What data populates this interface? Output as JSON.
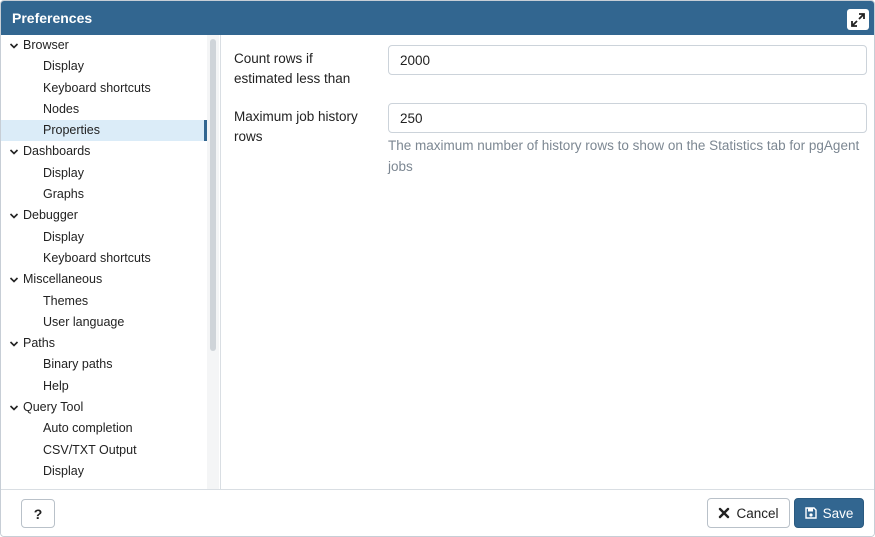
{
  "dialog": {
    "title": "Preferences"
  },
  "sidebar": {
    "tree": [
      {
        "label": "Browser",
        "level": "group"
      },
      {
        "label": "Display",
        "level": "child"
      },
      {
        "label": "Keyboard shortcuts",
        "level": "child"
      },
      {
        "label": "Nodes",
        "level": "child"
      },
      {
        "label": "Properties",
        "level": "child",
        "selected": true
      },
      {
        "label": "Dashboards",
        "level": "group"
      },
      {
        "label": "Display",
        "level": "child"
      },
      {
        "label": "Graphs",
        "level": "child"
      },
      {
        "label": "Debugger",
        "level": "group"
      },
      {
        "label": "Display",
        "level": "child"
      },
      {
        "label": "Keyboard shortcuts",
        "level": "child"
      },
      {
        "label": "Miscellaneous",
        "level": "group"
      },
      {
        "label": "Themes",
        "level": "child"
      },
      {
        "label": "User language",
        "level": "child"
      },
      {
        "label": "Paths",
        "level": "group"
      },
      {
        "label": "Binary paths",
        "level": "child"
      },
      {
        "label": "Help",
        "level": "child"
      },
      {
        "label": "Query Tool",
        "level": "group"
      },
      {
        "label": "Auto completion",
        "level": "child"
      },
      {
        "label": "CSV/TXT Output",
        "level": "child"
      },
      {
        "label": "Display",
        "level": "child"
      }
    ]
  },
  "content": {
    "count_rows": {
      "label": "Count rows if estimated less than",
      "value": "2000"
    },
    "max_job_history": {
      "label": "Maximum job history rows",
      "value": "250",
      "help": "The maximum number of history rows to show on the Statistics tab for pgAgent jobs"
    }
  },
  "footer": {
    "help_label": "?",
    "cancel_label": "Cancel",
    "save_label": "Save"
  },
  "colors": {
    "titlebar": "#326690",
    "selected_row": "#dbecf8",
    "primary_button": "#326690"
  }
}
